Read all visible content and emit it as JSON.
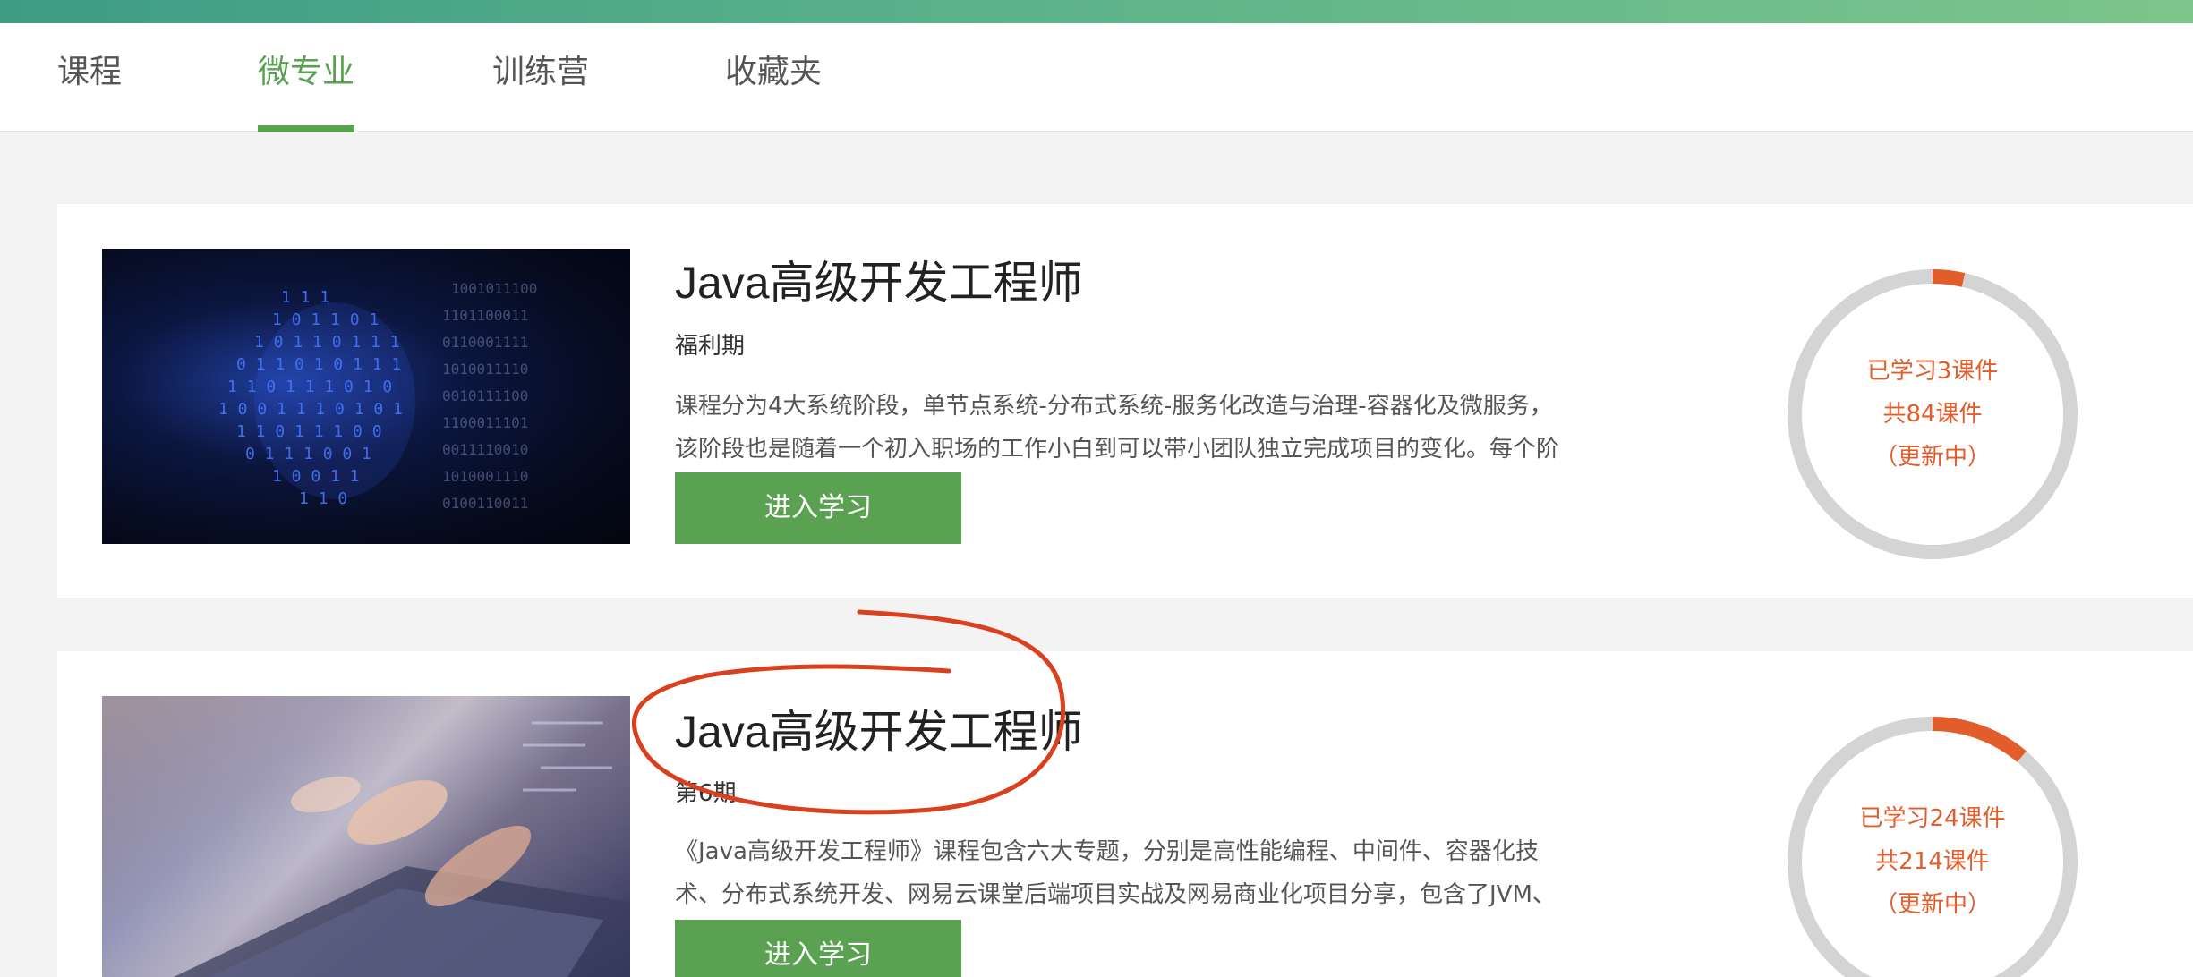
{
  "tabs": [
    {
      "label": "课程",
      "active": false
    },
    {
      "label": "微专业",
      "active": true
    },
    {
      "label": "训练营",
      "active": false
    },
    {
      "label": "收藏夹",
      "active": false
    }
  ],
  "courses": [
    {
      "title": "Java高级开发工程师",
      "period": "福利期",
      "desc_lines": [
        "课程分为4大系统阶段，单节点系统-分布式系统-服务化改造与治理-容器化及微服务，",
        "该阶段也是随着一个初入职场的工作小白到可以带小团队独立完成项目的变化。每个阶"
      ],
      "button_label": "进入学习",
      "progress": {
        "learned": "已学习3课件",
        "total": "共84课件",
        "status": "（更新中）",
        "fraction": 0.036
      }
    },
    {
      "title": "Java高级开发工程师",
      "period": "第6期",
      "desc_lines": [
        "《Java高级开发工程师》课程包含六大专题，分别是高性能编程、中间件、容器化技",
        "术、分布式系统开发、网易云课堂后端项目实战及网易商业化项目分享，包含了JVM、"
      ],
      "button_label": "进入学习",
      "progress": {
        "learned": "已学习24课件",
        "total": "共214课件",
        "status": "（更新中）",
        "fraction": 0.112
      }
    }
  ],
  "colors": {
    "accent": "#5aa152",
    "progress": "#e35d2a",
    "ring_track": "#d4d4d4",
    "annotation": "#d9401f"
  }
}
